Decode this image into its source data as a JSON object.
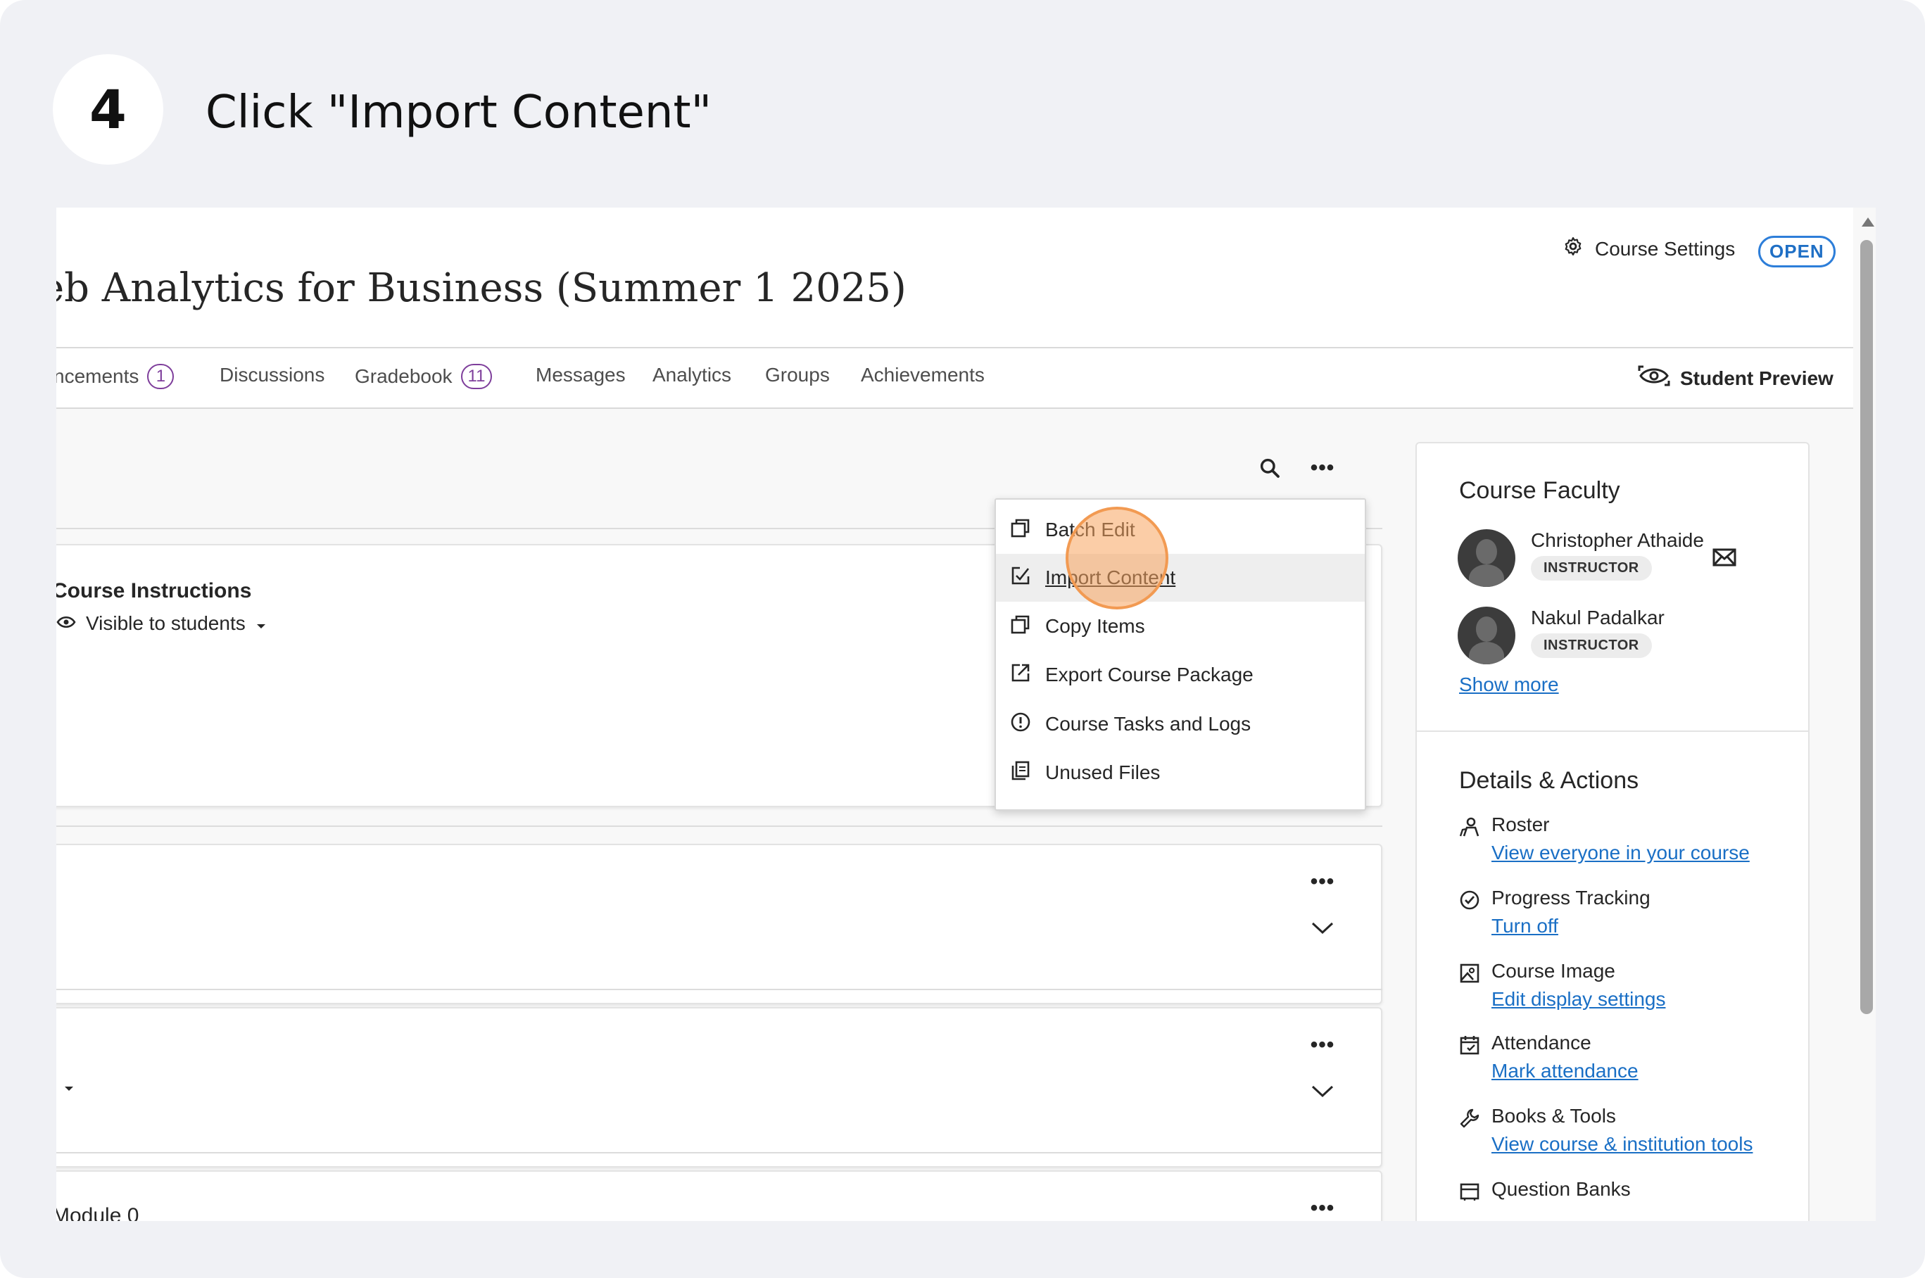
{
  "step": {
    "number": "4",
    "instruction": "Click \"Import Content\""
  },
  "header": {
    "course_title": "eb Analytics for Business (Summer 1 2025)",
    "settings_label": "Course Settings",
    "status_badge": "OPEN",
    "icons": [
      "gear-icon",
      "eye-refresh-icon"
    ]
  },
  "tabs": [
    {
      "label": "ncements",
      "count": "1"
    },
    {
      "label": "Discussions"
    },
    {
      "label": "Gradebook",
      "count": "11"
    },
    {
      "label": "Messages"
    },
    {
      "label": "Analytics"
    },
    {
      "label": "Groups"
    },
    {
      "label": "Achievements"
    }
  ],
  "student_preview_label": "Student Preview",
  "content": {
    "first_card_title": "Course Instructions",
    "visibility_label": "Visible to students",
    "last_card_title": "Module 0"
  },
  "menu": {
    "items": [
      {
        "label": "Batch Edit",
        "icon": "batch-edit-icon"
      },
      {
        "label": "Import Content",
        "icon": "import-icon",
        "active": true
      },
      {
        "label": "Copy Items",
        "icon": "copy-icon"
      },
      {
        "label": "Export Course Package",
        "icon": "export-icon"
      },
      {
        "label": "Course Tasks and Logs",
        "icon": "alert-circle-icon"
      },
      {
        "label": "Unused Files",
        "icon": "files-icon"
      }
    ]
  },
  "faculty": {
    "heading": "Course Faculty",
    "members": [
      {
        "name": "Christopher Athaide",
        "role": "INSTRUCTOR"
      },
      {
        "name": "Nakul Padalkar",
        "role": "INSTRUCTOR"
      }
    ],
    "show_more": "Show more"
  },
  "details": {
    "heading": "Details & Actions",
    "actions": [
      {
        "title": "Roster",
        "link": "View everyone in your course",
        "icon": "roster-icon"
      },
      {
        "title": "Progress Tracking",
        "link": "Turn off",
        "icon": "check-circle-icon"
      },
      {
        "title": "Course Image",
        "link": "Edit display settings",
        "icon": "image-icon"
      },
      {
        "title": "Attendance",
        "link": "Mark attendance",
        "icon": "calendar-icon"
      },
      {
        "title": "Books & Tools",
        "link": "View course & institution tools",
        "icon": "wrench-icon"
      },
      {
        "title": "Question Banks",
        "link": "",
        "icon": "bank-icon"
      }
    ]
  },
  "colors": {
    "accent_link": "#1a6fc5",
    "badge_purple": "#7e3e9b",
    "highlight_orange": "#f29a52"
  }
}
